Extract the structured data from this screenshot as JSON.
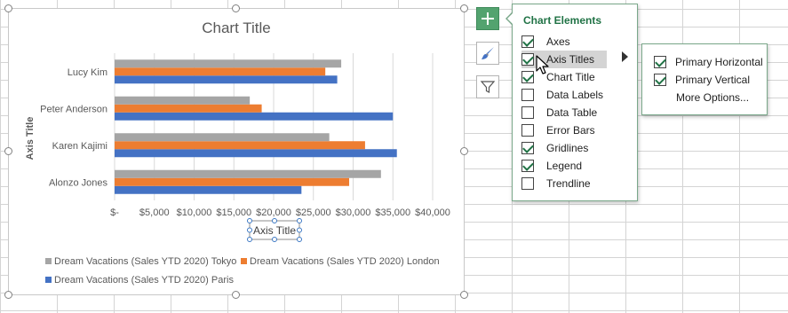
{
  "chart": {
    "title": "Chart Title",
    "x_axis_title": "Axis Title",
    "y_axis_title": "Axis Title"
  },
  "chart_data": {
    "type": "bar",
    "orientation": "horizontal",
    "categories": [
      "Alonzo Jones",
      "Karen Kajimi",
      "Peter Anderson",
      "Lucy Kim"
    ],
    "series": [
      {
        "name": "Dream Vacations (Sales YTD 2020) Paris",
        "color": "#4472c4",
        "values": [
          23500,
          35500,
          35000,
          28000
        ]
      },
      {
        "name": "Dream Vacations (Sales YTD 2020) London",
        "color": "#ed7d31",
        "values": [
          29500,
          31500,
          18500,
          26500
        ]
      },
      {
        "name": "Dream Vacations (Sales YTD 2020) Tokyo",
        "color": "#a5a5a5",
        "values": [
          33500,
          27000,
          17000,
          28500
        ]
      }
    ],
    "x_ticks": [
      "$-",
      "$5,000",
      "$10,000",
      "$15,000",
      "$20,000",
      "$25,000",
      "$30,000",
      "$35,000",
      "$40,000"
    ],
    "xlim": [
      0,
      40000
    ],
    "gridlines": true,
    "legend_position": "bottom"
  },
  "legend": {
    "tokyo": "Dream Vacations (Sales YTD 2020) Tokyo",
    "london": "Dream Vacations (Sales YTD 2020) London",
    "paris": "Dream Vacations (Sales YTD 2020) Paris"
  },
  "side_buttons": {
    "elements": "plus-icon",
    "styles": "brush-icon",
    "filters": "funnel-icon"
  },
  "chart_elements": {
    "title": "Chart Elements",
    "items": [
      {
        "label": "Axes",
        "checked": true
      },
      {
        "label": "Axis Titles",
        "checked": true
      },
      {
        "label": "Chart Title",
        "checked": true
      },
      {
        "label": "Data Labels",
        "checked": false
      },
      {
        "label": "Data Table",
        "checked": false
      },
      {
        "label": "Error Bars",
        "checked": false
      },
      {
        "label": "Gridlines",
        "checked": true
      },
      {
        "label": "Legend",
        "checked": true
      },
      {
        "label": "Trendline",
        "checked": false
      }
    ]
  },
  "axis_titles_submenu": {
    "items": [
      {
        "label": "Primary Horizontal",
        "checked": true
      },
      {
        "label": "Primary Vertical",
        "checked": true
      }
    ],
    "more_options": "More Options..."
  },
  "colors": {
    "excel_green": "#217346",
    "paris": "#4472c4",
    "london": "#ed7d31",
    "tokyo": "#a5a5a5"
  }
}
